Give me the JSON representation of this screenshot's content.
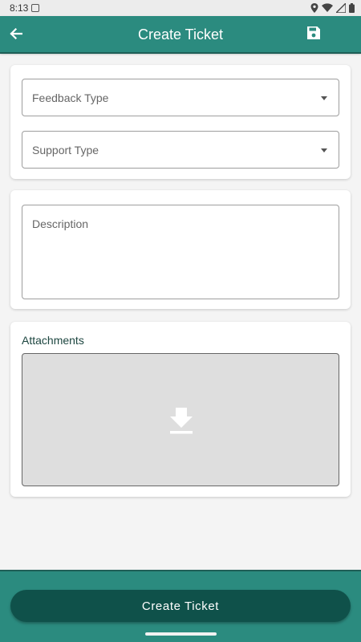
{
  "status_bar": {
    "time": "8:13",
    "icons": [
      "notification-icon",
      "location-icon",
      "wifi-icon",
      "signal-icon",
      "battery-icon"
    ]
  },
  "app_bar": {
    "title": "Create Ticket",
    "back_icon": "arrow-back-icon",
    "save_icon": "save-icon"
  },
  "form": {
    "feedback_type_label": "Feedback Type",
    "support_type_label": "Support Type",
    "description_label": "Description",
    "attachments_title": "Attachments",
    "attachment_icon": "download-icon"
  },
  "footer": {
    "create_button_label": "Create Ticket"
  },
  "colors": {
    "primary": "#2b8b7f",
    "primary_dark": "#0f514a",
    "background": "#f4f4f4"
  }
}
